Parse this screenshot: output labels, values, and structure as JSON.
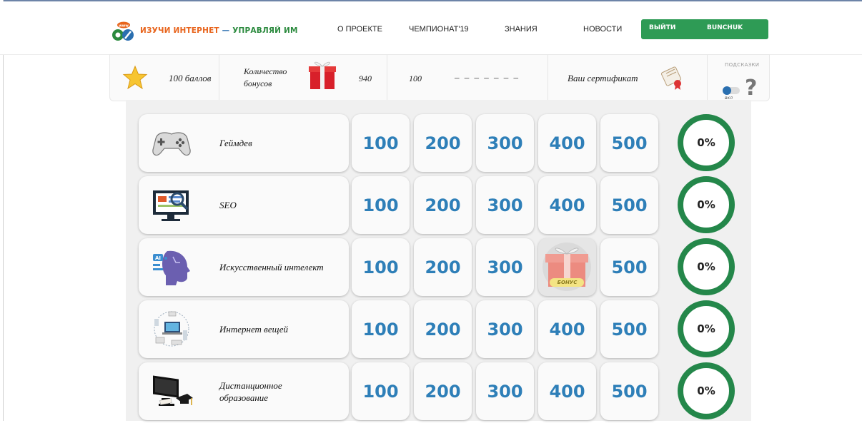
{
  "logo": {
    "part1": "ИЗУЧИ ИНТЕРНЕТ",
    "dash": " — ",
    "part2": "УПРАВЛЯЙ ИМ",
    "badge": "www"
  },
  "nav": {
    "items": [
      "О ПРОЕКТЕ",
      "ЧЕМПИОНАТ'19",
      "ЗНАНИЯ",
      "НОВОСТИ"
    ]
  },
  "auth": {
    "logout_label": "ВЫЙТИ",
    "username": "BUNCHUK"
  },
  "stats": {
    "points": "100 баллов",
    "bonus_label_line1": "Количество",
    "bonus_label_line2": "бонусов",
    "bonus_count": "940",
    "third_value": "100",
    "dashes": "– – – – – – –",
    "certificate": "Ваш сертификат",
    "hints_label": "ПОДСКАЗКИ",
    "toggle_label": "вкл",
    "toggle_on": true,
    "help_symbol": "?"
  },
  "colors": {
    "value_text": "#2e7fb8",
    "ring": "#24874a",
    "auth_button": "#2e9b55",
    "logo_orange": "#e8641c",
    "logo_green": "#2b8a3e"
  },
  "board": {
    "rows": [
      {
        "category": "Геймдев",
        "icon": "gamepad-icon",
        "values": [
          "100",
          "200",
          "300",
          "400",
          "500"
        ],
        "bonus_index": -1,
        "progress": "0%"
      },
      {
        "category": "SEO",
        "icon": "seo-monitor-icon",
        "values": [
          "100",
          "200",
          "300",
          "400",
          "500"
        ],
        "bonus_index": -1,
        "progress": "0%"
      },
      {
        "category": "Искусственный интелект",
        "icon": "ai-head-icon",
        "values": [
          "100",
          "200",
          "300",
          "",
          "500"
        ],
        "bonus_index": 3,
        "progress": "0%"
      },
      {
        "category": "Интернет вещей",
        "icon": "iot-devices-icon",
        "values": [
          "100",
          "200",
          "300",
          "400",
          "500"
        ],
        "bonus_index": -1,
        "progress": "0%"
      },
      {
        "category_line1": "Дистанционное",
        "category_line2": "образование",
        "icon": "distance-education-icon",
        "values": [
          "100",
          "200",
          "300",
          "400",
          "500"
        ],
        "bonus_index": -1,
        "progress": "0%"
      }
    ],
    "bonus_label": "БОНУС"
  }
}
